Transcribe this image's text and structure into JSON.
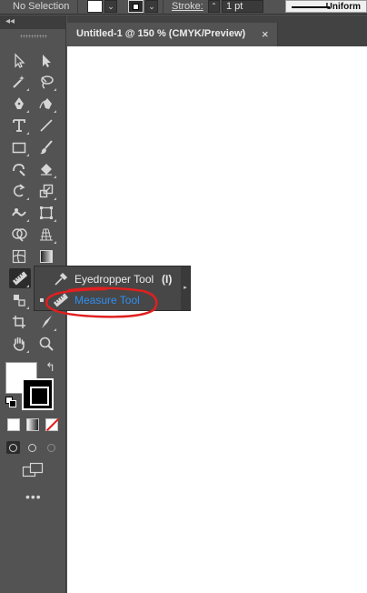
{
  "control_bar": {
    "selection_label": "No Selection",
    "stroke_label": "Stroke:",
    "stroke_weight": "1 pt",
    "profile_label": "Uniform"
  },
  "toolbar": {
    "collapse_glyph": "◂◂",
    "tools": [
      {
        "name": "selection-tool",
        "icon": "arrow-icon"
      },
      {
        "name": "direct-selection-tool",
        "icon": "white-arrow-icon"
      },
      {
        "name": "magic-wand-tool",
        "icon": "magic-wand-icon"
      },
      {
        "name": "lasso-tool",
        "icon": "lasso-icon"
      },
      {
        "name": "pen-tool",
        "icon": "pen-icon"
      },
      {
        "name": "curvature-tool",
        "icon": "curvature-pen-icon"
      },
      {
        "name": "type-tool",
        "icon": "type-icon"
      },
      {
        "name": "line-tool",
        "icon": "line-segment-icon"
      },
      {
        "name": "rectangle-tool",
        "icon": "rectangle-icon"
      },
      {
        "name": "paintbrush-tool",
        "icon": "paintbrush-icon"
      },
      {
        "name": "shaper-tool",
        "icon": "shaper-icon"
      },
      {
        "name": "eraser-tool",
        "icon": "eraser-icon"
      },
      {
        "name": "rotate-tool",
        "icon": "rotate-icon"
      },
      {
        "name": "scale-tool",
        "icon": "scale-icon"
      },
      {
        "name": "warp-tool",
        "icon": "warp-icon"
      },
      {
        "name": "free-transform-tool",
        "icon": "free-transform-icon"
      },
      {
        "name": "shape-builder-tool",
        "icon": "shape-builder-icon"
      },
      {
        "name": "perspective-grid-tool",
        "icon": "perspective-grid-icon"
      },
      {
        "name": "mesh-tool",
        "icon": "mesh-icon"
      },
      {
        "name": "gradient-tool",
        "icon": "gradient-icon"
      },
      {
        "name": "measure-tool-active",
        "icon": "ruler-icon"
      },
      {
        "name": "blend-tool",
        "icon": "blend-icon"
      },
      {
        "name": "symbol-sprayer-tool",
        "icon": "symbol-sprayer-icon"
      },
      {
        "name": "artboard-tool",
        "icon": "artboard-icon"
      },
      {
        "name": "slice-tool",
        "icon": "slice-icon"
      },
      {
        "name": "hand-tool",
        "icon": "hand-icon"
      },
      {
        "name": "zoom-tool",
        "icon": "magnifier-icon"
      }
    ],
    "more_label": "•••"
  },
  "document": {
    "tab_title": "Untitled-1 @ 150 % (CMYK/Preview)",
    "close_glyph": "×",
    "canvas_color": "#ffffff"
  },
  "flyout": {
    "items": [
      {
        "label": "Eyedropper Tool",
        "shortcut": "(I)",
        "selected": false
      },
      {
        "label": "Measure Tool",
        "shortcut": "",
        "selected": true
      }
    ],
    "expand_glyph": "▸"
  },
  "colors": {
    "ui_bg": "#535353",
    "selected_text": "#2e8ef0",
    "annotation": "#e02020"
  }
}
